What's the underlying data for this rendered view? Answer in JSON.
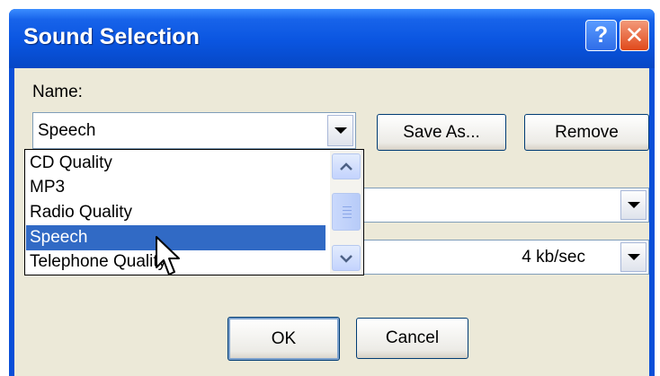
{
  "window": {
    "title": "Sound Selection",
    "help_label": "?",
    "close_label": "✕"
  },
  "name_label": "Name:",
  "name_combo": {
    "value": "Speech",
    "options": [
      "CD Quality",
      "MP3",
      "Radio Quality",
      "Speech",
      "Telephone Quality"
    ],
    "selected_index": 3
  },
  "buttons": {
    "save_as": "Save As...",
    "remove": "Remove",
    "ok": "OK",
    "cancel": "Cancel"
  },
  "format_combo": {
    "value": ""
  },
  "attributes_combo": {
    "value": "4 kb/sec"
  },
  "icons": {
    "dropdown": "chevron-down-icon",
    "scroll_up": "chevron-up-icon",
    "scroll_down": "chevron-down-icon",
    "cursor": "mouse-pointer-icon"
  },
  "colors": {
    "title_bar": "#0a55e0",
    "selection": "#316ac5",
    "dialog_bg": "#ece9d8"
  }
}
